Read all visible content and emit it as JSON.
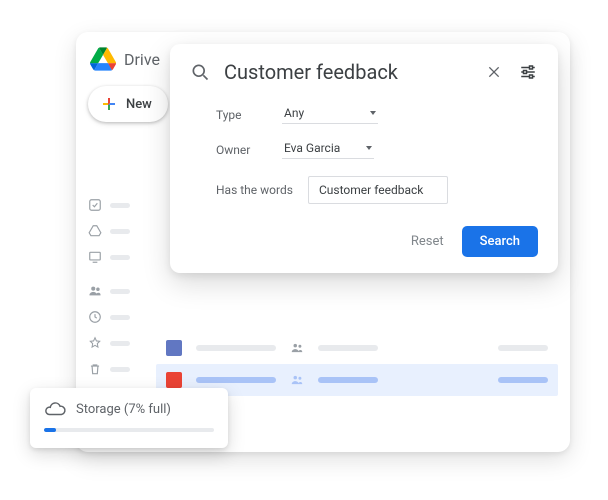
{
  "app": {
    "name": "Drive"
  },
  "new_btn": {
    "label": "New"
  },
  "search": {
    "query": "Customer feedback",
    "filters": {
      "type": {
        "label": "Type",
        "value": "Any"
      },
      "owner": {
        "label": "Owner",
        "value": "Eva Garcia"
      },
      "words": {
        "label": "Has the words",
        "value": "Customer feedback"
      }
    },
    "reset": "Reset",
    "submit": "Search"
  },
  "storage": {
    "label": "Storage (7% full)",
    "percent": 7
  }
}
